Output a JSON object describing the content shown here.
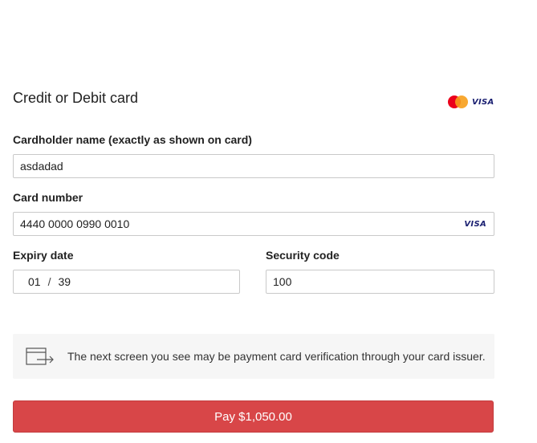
{
  "form": {
    "title": "Credit or Debit card",
    "accepted_brands": [
      "mastercard-logo",
      "visa-logo"
    ],
    "visa_text": "VISA",
    "cardholder": {
      "label": "Cardholder name (exactly as shown on card)",
      "value": "asdadad"
    },
    "card_number": {
      "label": "Card number",
      "value": "4440 0000 0990 0010",
      "detected_brand": "VISA"
    },
    "expiry": {
      "label": "Expiry date",
      "month": "01",
      "separator": "/",
      "year": "39"
    },
    "security_code": {
      "label": "Security code",
      "value": "100"
    }
  },
  "notice": {
    "icon": "card-redirect-icon",
    "text": "The next screen you see may be payment card verification through your card issuer."
  },
  "pay_button": {
    "label": "Pay $1,050.00",
    "color": "#d84648"
  }
}
